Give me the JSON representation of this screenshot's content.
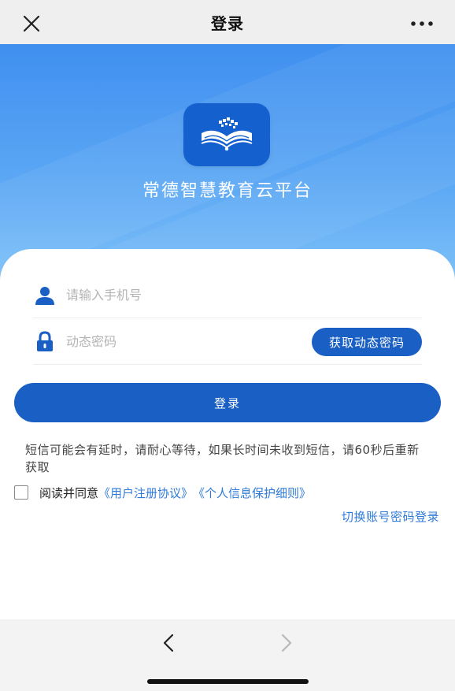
{
  "titlebar": {
    "title": "登录",
    "close_icon": "close-icon",
    "more_icon": "more-icon"
  },
  "hero": {
    "logo_icon": "open-book-logo-icon",
    "app_name": "常德智慧教育云平台",
    "gradient_top": "#3f8ff0",
    "gradient_bottom": "#7cc0f8"
  },
  "form": {
    "phone_icon": "user-icon",
    "phone_placeholder": "请输入手机号",
    "phone_value": "",
    "code_icon": "lock-icon",
    "code_placeholder": "动态密码",
    "code_value": "",
    "get_code_label": "获取动态密码",
    "login_label": "登录",
    "accent_color": "#1a5fc4"
  },
  "notice": {
    "text": "短信可能会有延时，请耐心等待，如果长时间未收到短信，请60秒后重新获取"
  },
  "agreement": {
    "checked": false,
    "prefix": "阅读并同意",
    "link_terms": "《用户注册协议》",
    "link_privacy": "《个人信息保护细则》",
    "link_color": "#2e7ad8"
  },
  "switch_login": {
    "label": "切换账号密码登录"
  },
  "bottombar": {
    "back_icon": "chevron-left-icon",
    "forward_icon": "chevron-right-icon"
  }
}
